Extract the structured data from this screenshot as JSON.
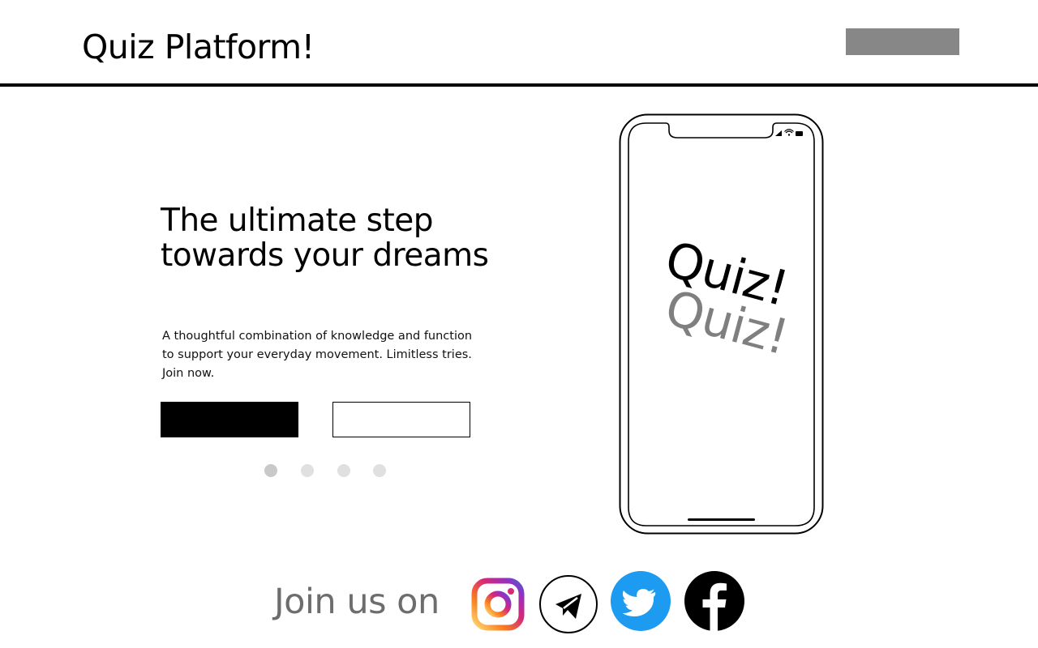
{
  "header": {
    "brand": "Quiz Platform!",
    "nav_button_label": ""
  },
  "hero": {
    "title": "The ultimate step towards your dreams",
    "description": "A thoughtful combination of knowledge and function to support your everyday movement. Limitless tries. Join now.",
    "primary_button_label": "",
    "secondary_button_label": "",
    "slides": {
      "count": 4,
      "active_index": 0
    }
  },
  "phone": {
    "screen_text_primary": "Quiz!",
    "screen_text_secondary": "Quiz!"
  },
  "footer": {
    "join_text": "Join us on",
    "social": [
      {
        "name": "Instagram",
        "icon": "instagram-icon"
      },
      {
        "name": "Telegram",
        "icon": "telegram-icon"
      },
      {
        "name": "Twitter",
        "icon": "twitter-icon"
      },
      {
        "name": "Facebook",
        "icon": "facebook-icon"
      }
    ]
  },
  "colors": {
    "accent_gray": "#878787",
    "twitter_blue": "#1d9bf0",
    "instagram_gradient": [
      "#feda75",
      "#fa7e1e",
      "#d62976",
      "#962fbf",
      "#4f5bd5"
    ]
  }
}
